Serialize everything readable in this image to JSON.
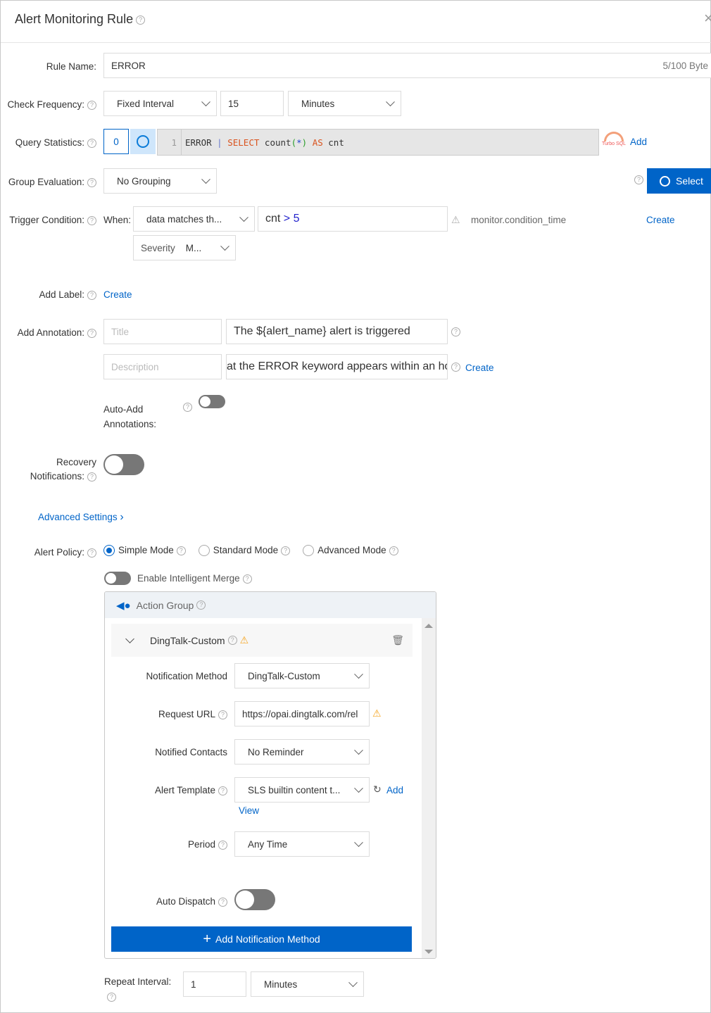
{
  "header": {
    "title": "Alert Monitoring Rule",
    "close": "×"
  },
  "rule_name": {
    "label": "Rule Name:",
    "value": "ERROR",
    "counter": "5/100 Byte"
  },
  "check_frequency": {
    "label": "Check Frequency:",
    "type": "Fixed Interval",
    "value": "15",
    "unit": "Minutes"
  },
  "query_statistics": {
    "label": "Query Statistics:",
    "index": "0",
    "line_no": "1",
    "query": {
      "t1": "ERROR",
      "pipe": "|",
      "kw1": "SELECT",
      "fn": "count",
      "p1": "(",
      "star": "*",
      "p2": ")",
      "kw2": "AS",
      "alias": "cnt"
    },
    "turbo": "Turbo SQL",
    "add": "Add"
  },
  "group_evaluation": {
    "label": "Group Evaluation:",
    "value": "No Grouping",
    "select": "Select"
  },
  "trigger_condition": {
    "label": "Trigger Condition:",
    "when": "When:",
    "match": "data matches th...",
    "expr_var": "cnt",
    "expr_op": ">",
    "expr_val": "5",
    "hint": "monitor.condition_time",
    "create": "Create",
    "severity_label": "Severity",
    "severity_value": "M..."
  },
  "add_label": {
    "label": "Add Label:",
    "create": "Create"
  },
  "add_annotation": {
    "label": "Add Annotation:",
    "title_placeholder": "Title",
    "title_value": "The ${alert_name} alert is triggered",
    "desc_placeholder": "Description",
    "desc_value": "at the ERROR keyword appears within an hou",
    "create": "Create"
  },
  "auto_add": {
    "label1": "Auto-Add",
    "label2": "Annotations:",
    "on": false
  },
  "recovery": {
    "label1": "Recovery",
    "label2": "Notifications:",
    "on": false
  },
  "advanced_settings": "Advanced Settings",
  "alert_policy": {
    "label": "Alert Policy:",
    "modes": [
      "Simple Mode",
      "Standard Mode",
      "Advanced Mode"
    ],
    "selected": "Simple Mode",
    "merge": "Enable Intelligent Merge"
  },
  "action_group": {
    "title": "Action Group",
    "item": "DingTalk-Custom",
    "notification_method": {
      "label": "Notification Method",
      "value": "DingTalk-Custom"
    },
    "request_url": {
      "label": "Request URL",
      "value": "https://opai.dingtalk.com/rel"
    },
    "notified_contacts": {
      "label": "Notified Contacts",
      "value": "No Reminder"
    },
    "alert_template": {
      "label": "Alert Template",
      "value": "SLS builtin content t...",
      "add": "Add",
      "view": "View"
    },
    "period": {
      "label": "Period",
      "value": "Any Time"
    },
    "auto_dispatch": {
      "label": "Auto Dispatch",
      "on": false
    },
    "add_method": "Add Notification Method"
  },
  "repeat_interval": {
    "label": "Repeat Interval:",
    "value": "1",
    "unit": "Minutes"
  },
  "colors": {
    "accent": "#0064c8",
    "warning": "#f5a623"
  }
}
